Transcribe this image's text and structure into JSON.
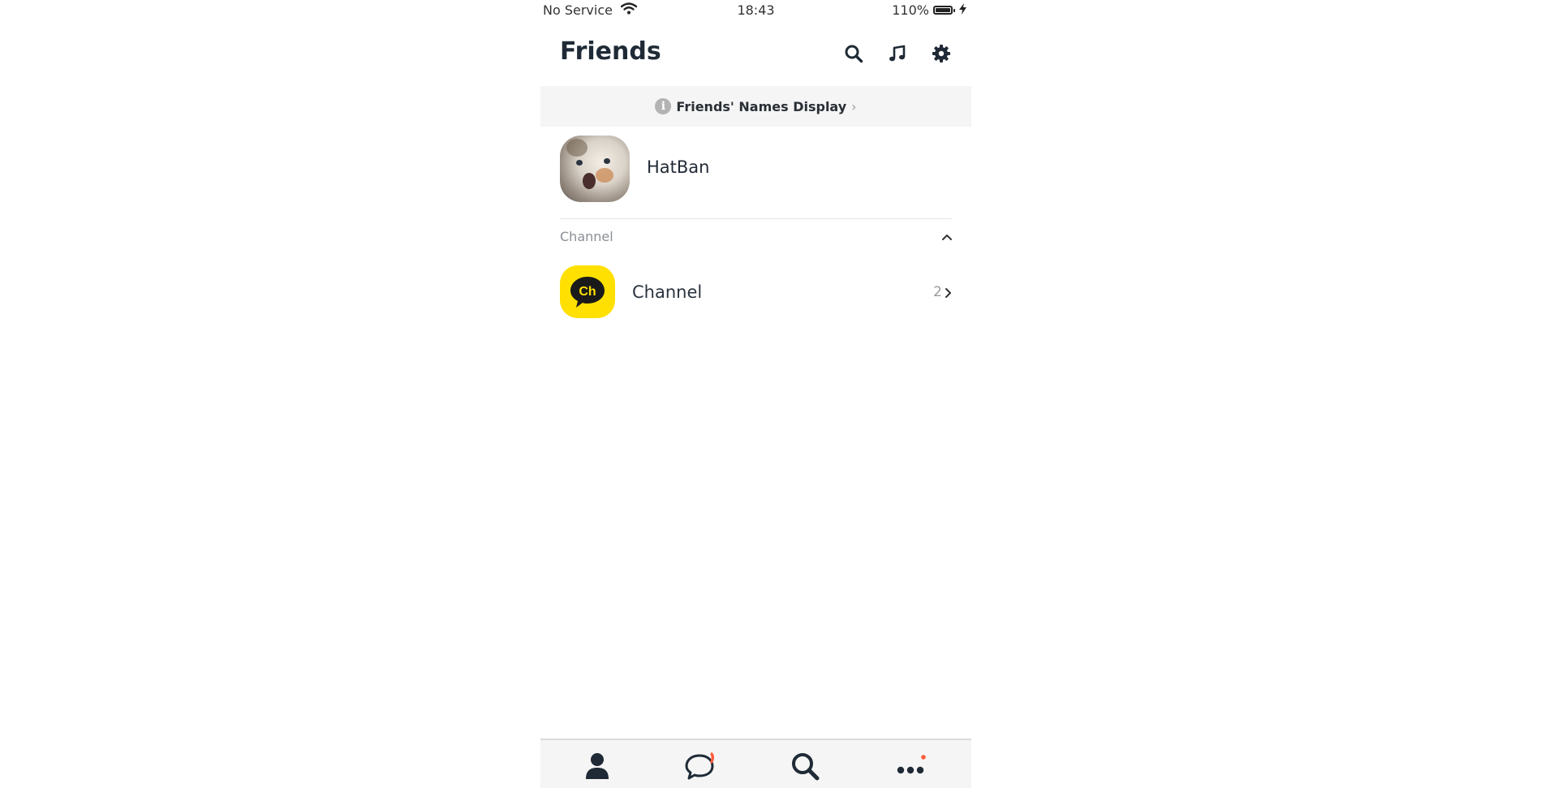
{
  "status_bar": {
    "carrier": "No Service",
    "time": "18:43",
    "battery": "110%",
    "battery_level": 1.0
  },
  "header": {
    "title": "Friends",
    "icons": [
      "search-icon",
      "music-note-icon",
      "gear-icon"
    ]
  },
  "notice": {
    "text": "Friends' Names Display",
    "info_glyph": "i",
    "chevron": "›"
  },
  "profile": {
    "name": "HatBan"
  },
  "channel_section": {
    "label": "Channel",
    "item": {
      "name": "Channel",
      "count": "2",
      "icon_text": "Ch"
    }
  },
  "bottom_nav": {
    "items": [
      "friends-tab",
      "chats-tab",
      "search-tab",
      "more-tab"
    ],
    "badge_color": "#ff5a3c"
  },
  "colors": {
    "accent_yellow": "#ffe000",
    "text_dark": "#1f2a36"
  }
}
